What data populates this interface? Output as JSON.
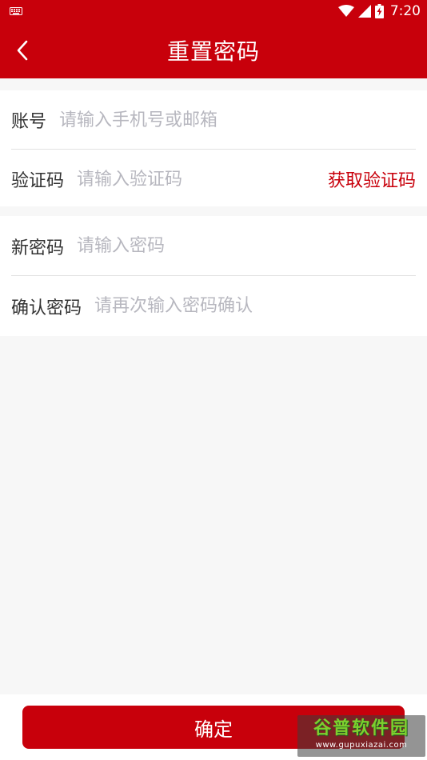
{
  "status_bar": {
    "time": "7:20",
    "icons": [
      "keyboard-icon",
      "wifi-icon",
      "cellular-signal-icon",
      "battery-charging-icon"
    ]
  },
  "app_bar": {
    "title": "重置密码",
    "back_icon": "chevron-left-icon"
  },
  "form": {
    "account": {
      "label": "账号",
      "placeholder": "请输入手机号或邮箱",
      "value": ""
    },
    "verify_code": {
      "label": "验证码",
      "placeholder": "请输入验证码",
      "value": "",
      "action_label": "获取验证码"
    },
    "new_password": {
      "label": "新密码",
      "placeholder": "请输入密码",
      "value": ""
    },
    "confirm_password": {
      "label": "确认密码",
      "placeholder": "请再次输入密码确认",
      "value": ""
    }
  },
  "footer": {
    "confirm_label": "确定"
  },
  "watermark": {
    "title": "谷普软件园",
    "url": "www.gupuxiazai.com"
  },
  "colors": {
    "brand": "#c8000b",
    "placeholder": "#b7b7bf",
    "background": "#f7f7f7"
  }
}
